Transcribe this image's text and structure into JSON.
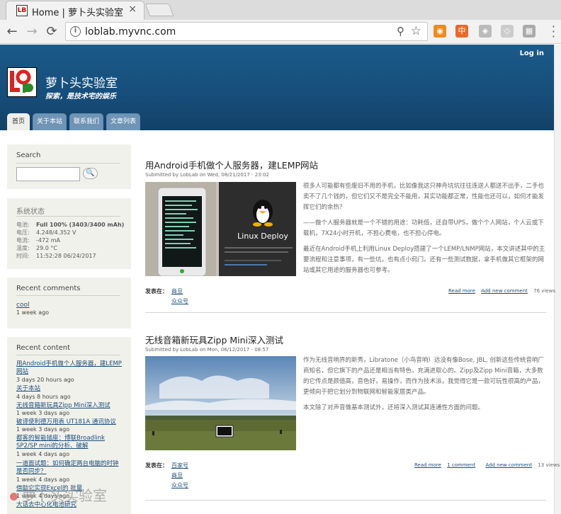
{
  "browser": {
    "tab_title": "Home | 萝卜头实验室",
    "tab_close": "×",
    "favicon_text": "LB",
    "url": "loblab.myvnc.com",
    "back": "←",
    "forward": "→",
    "reload": "⟳",
    "info_icon": "i",
    "zoom_icon": "⚲",
    "star_icon": "☆",
    "extensions": [
      {
        "name": "rss-icon",
        "color": "#f08a1c",
        "glyph": "◉"
      },
      {
        "name": "translate-ext-icon",
        "color": "#e8692b",
        "glyph": "中"
      },
      {
        "name": "shield-ext-icon",
        "color": "#bbbbbb",
        "glyph": "◈"
      },
      {
        "name": "pocket-ext-icon",
        "color": "#cccccc",
        "glyph": "◇"
      },
      {
        "name": "screenshot-ext-icon",
        "color": "#aaaaaa",
        "glyph": "▦"
      }
    ]
  },
  "header": {
    "login": "Log in",
    "site_name": "萝卜头实验室",
    "slogan": "探索，是技术宅的娱乐",
    "tabs": [
      "首页",
      "关于本站",
      "联系我们",
      "文章列表"
    ]
  },
  "sidebar": {
    "search": {
      "title": "Search",
      "button": "🔍"
    },
    "status": {
      "title": "系统状态",
      "rows": [
        {
          "label": "电池:",
          "value": "Full 100% (3403/3400 mAh)"
        },
        {
          "label": "电压:",
          "value": "4.248/4.352 V"
        },
        {
          "label": "电流:",
          "value": "-472 mA"
        },
        {
          "label": "温度:",
          "value": "29.0 °C"
        },
        {
          "label": "时间:",
          "value": "11:52:28 06/24/2017"
        }
      ]
    },
    "comments": {
      "title": "Recent comments",
      "items": [
        {
          "text": "cool",
          "ago": "1 week ago"
        }
      ]
    },
    "recent": {
      "title": "Recent content",
      "items": [
        {
          "text": "用Android手机做个人服务器，建LEMP网站",
          "ago": "3 days 20 hours ago"
        },
        {
          "text": "关于本站",
          "ago": "4 days 8 hours ago"
        },
        {
          "text": "无线音箱新玩具Zipp Mini深入测试",
          "ago": "1 week 3 days ago"
        },
        {
          "text": "破译使利德万用表 UT181A 通讯协议",
          "ago": "1 week 3 days ago"
        },
        {
          "text": "都客的智能插座：博联Broadlink SP2/SP mini的分析、破解",
          "ago": "1 week 4 days ago"
        },
        {
          "text": "一道面试题：如何确定两台电脑的时钟是否同步？",
          "ago": "1 week 4 days ago"
        },
        {
          "text": "借助它实现Excel的 批量",
          "ago": "1 week 4 days ago"
        },
        {
          "text": "大话去中心化电池研究",
          "ago": ""
        }
      ]
    }
  },
  "articles": [
    {
      "title": "用Android手机做个人服务器，建LEMP网站",
      "submitted": "Submitted by LobLab on Wed, 08/21/2017 - 23:02",
      "image_caption": "Linux Deploy",
      "paragraphs": [
        "很多人可能都有些废旧不用的手机，比如像我这只神舟坑坑往往连送人都送不出手，二手也卖不了几个钱的，但它们又不是完全不能用，其实功能都正常，性能也还可以，如何才能发挥它们的余热？",
        "——做个人服务器就是一个不错的用途：功耗低，还自带UPS，做个个人网站，个人云或下载机，7X24小时开机，不担心费电，也不担心停电。",
        "最近在Android手机上利用Linux Deploy搭建了一个LEMP/LNMP网站，本文讲述其中的主要流程和注意事项，有一些坑，也有点小窍门。还有一些测试数据，拿手机做其它框架的网站或其它用途的服务器也可参考。"
      ],
      "tax_label": "发表在：",
      "tags": [
        "商旦",
        "众众号"
      ],
      "links": {
        "read_more": "Read more",
        "add_comment": "Add new comment",
        "views": "76 views"
      }
    },
    {
      "title": "无线音箱新玩具Zipp Mini深入测试",
      "submitted": "Submitted by LobLab on Mon, 06/12/2017 - 08:57",
      "paragraphs": [
        "作为无线音响界的新秀，Libratone（小鸟音响）远没有像Bose, JBL, 创新这些传统音响厂商知名，但它旗下的产品还是相当有特色，充满进取心的。Zipp及Zipp Mini音箱，大多数的它传点是颜值高，音色好，易操作，而作为技术派，我觉得它是一款可玩性很高的产品，更倾向于把它划分到物联网和智能家居类产品。",
        "本文除了对声音做基本测试外，还将深入测试其连通性方面的问题。"
      ],
      "tax_label": "发表在：",
      "tags": [
        "百家号",
        "商旦",
        "众众号"
      ],
      "links": {
        "read_more": "Read more",
        "comment": "1 comment",
        "add_comment": "Add new comment",
        "views": "13 views"
      }
    }
  ],
  "watermark": "萝卜头实验室"
}
